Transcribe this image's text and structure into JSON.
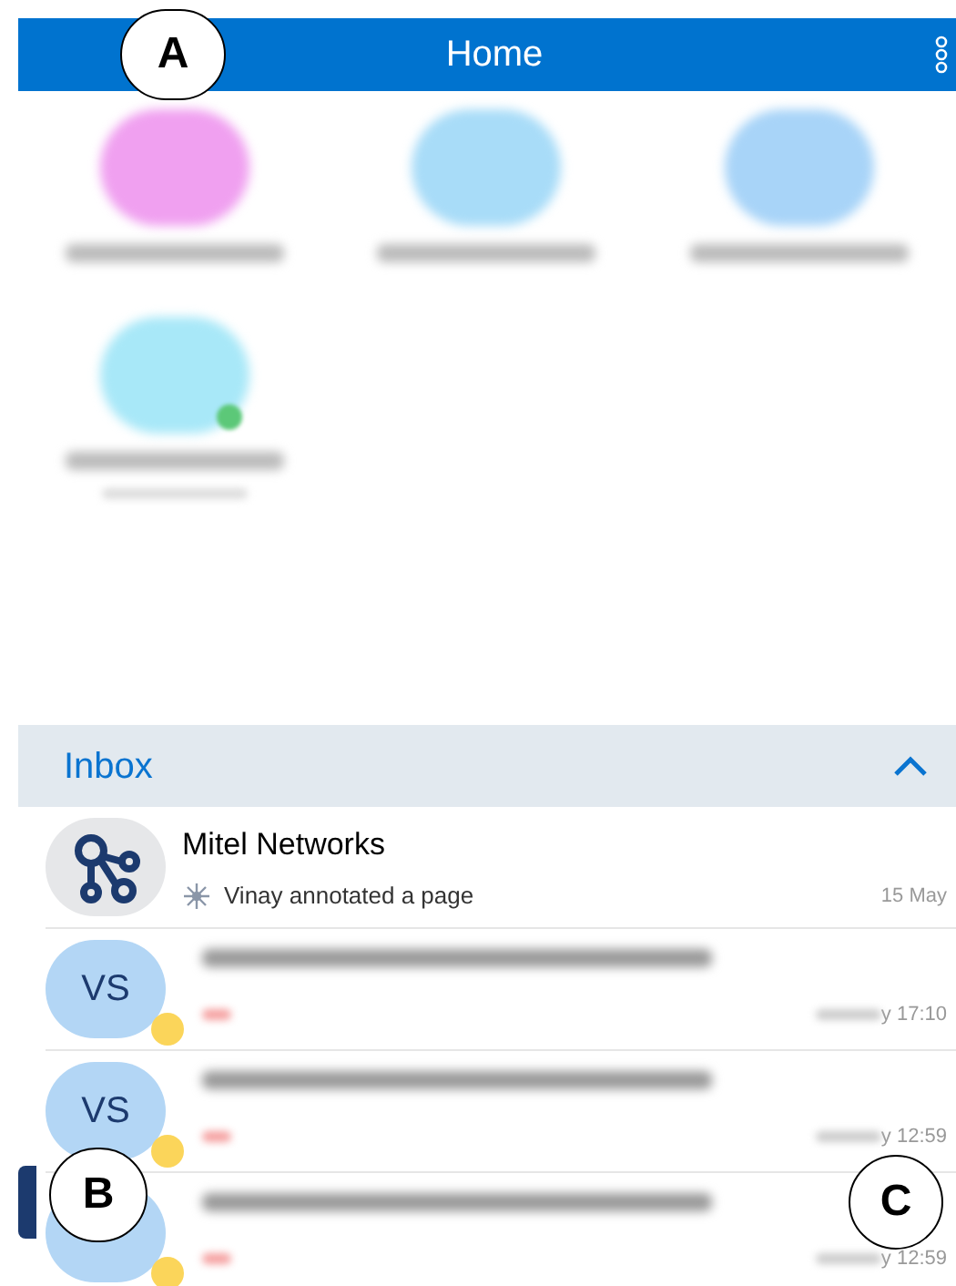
{
  "header": {
    "title": "Home"
  },
  "favorites": [
    {
      "color": "#f0a0f0",
      "online": false
    },
    {
      "color": "#a8dcf8",
      "online": false
    },
    {
      "color": "#a8d4f8",
      "online": false
    },
    {
      "color": "#a8e8f8",
      "online": true
    }
  ],
  "inbox": {
    "title": "Inbox",
    "expanded": true,
    "items": [
      {
        "kind": "app",
        "name": "Mitel Networks",
        "preview": "Vinay annotated a page",
        "time": "15 May"
      },
      {
        "kind": "contact",
        "initials": "VS",
        "time": "y 17:10"
      },
      {
        "kind": "contact",
        "initials": "VS",
        "time": "y 12:59"
      },
      {
        "kind": "contact",
        "time": "y 12:59"
      }
    ]
  },
  "callouts": [
    {
      "label": "A"
    },
    {
      "label": "B"
    },
    {
      "label": "C"
    }
  ]
}
